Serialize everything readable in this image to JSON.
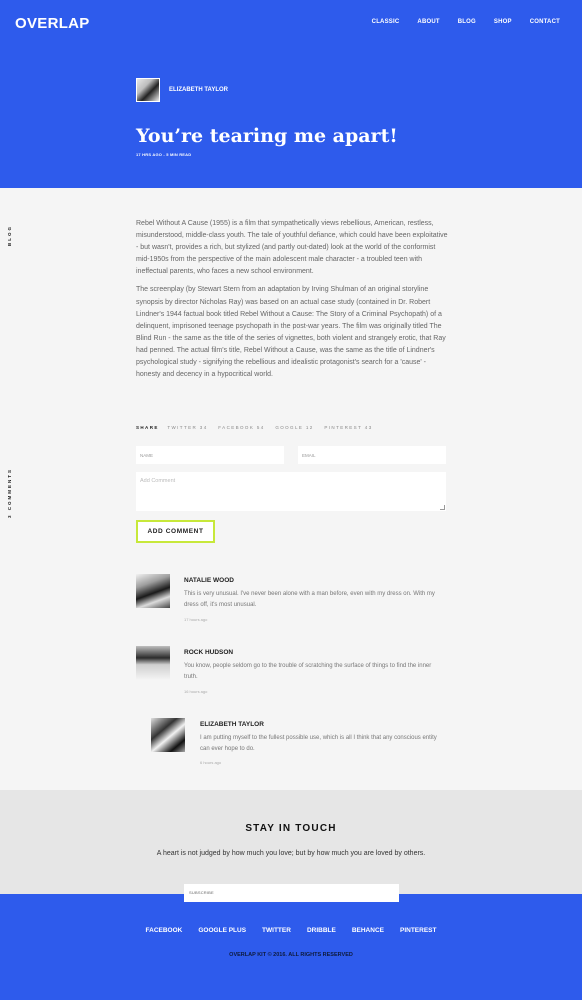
{
  "header": {
    "logo": "OVERLAP",
    "nav": [
      "CLASSIC",
      "ABOUT",
      "BLOG",
      "SHOP",
      "CONTACT"
    ]
  },
  "post": {
    "author": "ELIZABETH TAYLOR",
    "title": "You’re tearing me apart!",
    "meta": "17 HRS AGO - 5 MIN READ",
    "side_label": "BLOG",
    "comments_label": "3 COMMENTS",
    "paragraphs": [
      "Rebel Without A Cause (1955) is a film that sympathetically views rebellious, American, restless, misunderstood, middle-class youth. The tale of youthful defiance, which could have been exploitative - but wasn't, provides a rich, but stylized (and partly out-dated) look at the world of the conformist mid-1950s from the perspective of the main adolescent male character - a troubled teen with ineffectual parents, who faces a new school environment.",
      "The screenplay (by Stewart Stern from an adaptation by Irving Shulman of an original storyline synopsis by director Nicholas Ray) was based on an actual case study (contained in Dr. Robert Lindner's 1944 factual book titled Rebel Without a Cause: The Story of a Criminal Psychopath) of a delinquent, imprisoned teenage psychopath in the post-war years. The film was originally titled The Blind Run - the same as the title of the series of vignettes, both violent and strangely erotic, that Ray had penned. The actual film's title, Rebel Without a Cause, was the same as the title of Lindner's psychological study - signifying the rebellious and idealistic protagonist's search for a 'cause' - honesty and decency in a hypocritical world."
    ]
  },
  "share": {
    "label": "SHARE",
    "items": [
      "TWITTER 34",
      "FACEBOOK 54",
      "GOOGLE 12",
      "PINTEREST 43"
    ]
  },
  "form": {
    "name_placeholder": "NAME",
    "email_placeholder": "EMAIL",
    "comment_placeholder": "Add Comment",
    "submit_label": "ADD COMMENT"
  },
  "comments": [
    {
      "name": "NATALIE WOOD",
      "text": "This is very unusual. I've never been alone with a man before, even with my dress on. With my dress off, it's most unusual.",
      "time": "17 hours ago"
    },
    {
      "name": "ROCK HUDSON",
      "text": "You know, people seldom go to the trouble of scratching the surface of things to find the inner truth.",
      "time": "16 hours ago"
    },
    {
      "name": "ELIZABETH TAYLOR",
      "text": "I am putting myself to the fullest possible use, which is all I think that any conscious entity can ever hope to do.",
      "time": "6 hours ago"
    }
  ],
  "newsletter": {
    "title": "STAY IN TOUCH",
    "quote": "A heart is not judged by how much you love; but by how much you are loved by others.",
    "subscribe_placeholder": "SUBSCRIBE"
  },
  "footer": {
    "social": [
      "FACEBOOK",
      "GOOGLE PLUS",
      "TWITTER",
      "DRIBBLE",
      "BEHANCE",
      "PINTEREST"
    ],
    "copyright": "OVERLAP KIT © 2016. ALL RIGHTS RESERVED"
  },
  "colors": {
    "brand_blue": "#2e5bec",
    "accent_green": "#c7e83a",
    "content_bg": "#f5f5f5"
  }
}
